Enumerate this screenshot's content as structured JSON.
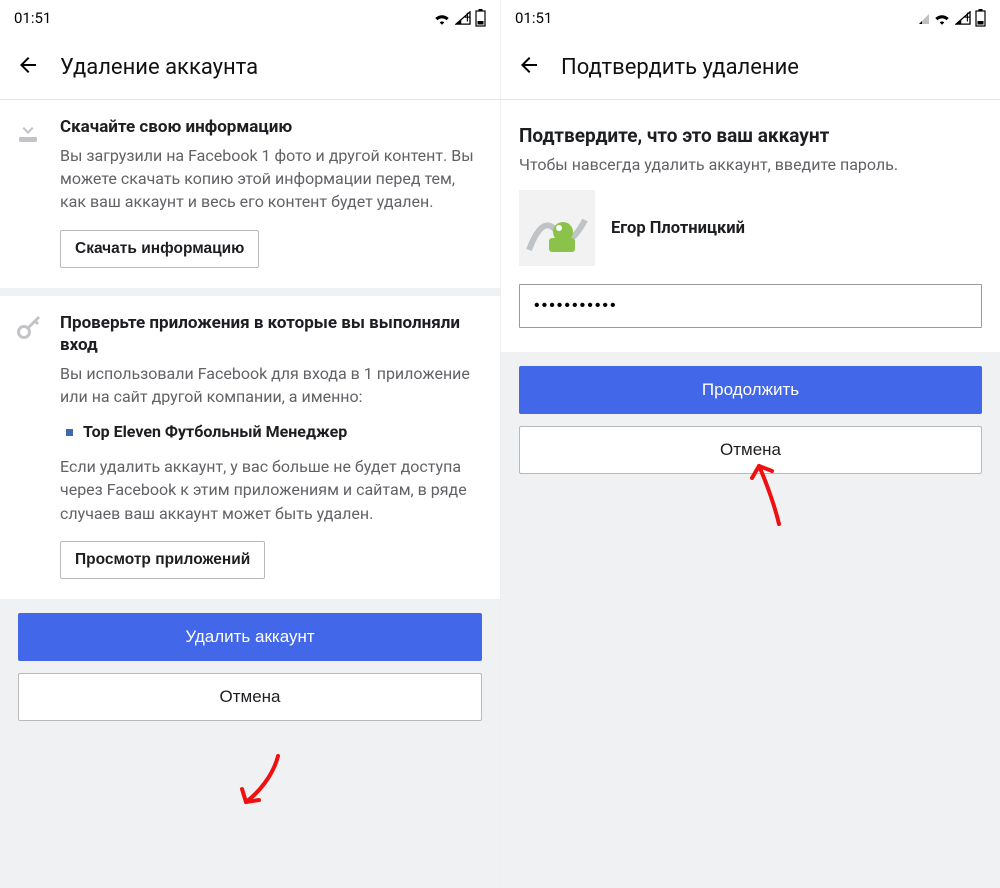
{
  "status": {
    "time": "01:51"
  },
  "left": {
    "nav_title": "Удаление аккаунта",
    "download": {
      "heading": "Скачайте свою информацию",
      "body": "Вы загрузили на Facebook 1 фото и другой контент. Вы можете скачать копию этой информации перед тем, как ваш аккаунт и весь его контент будет удален.",
      "button": "Скачать информацию"
    },
    "apps": {
      "heading": "Проверьте приложения в которые вы выполняли вход",
      "intro": "Вы использовали Facebook для входа в 1 приложение или на сайт другой компании, а именно:",
      "app_name": "Top Eleven Футбольный Менеджер",
      "explain": "Если удалить аккаунт, у вас больше не будет доступа через Facebook к этим приложениям и сайтам, в ряде случаев ваш аккаунт может быть удален.",
      "button": "Просмотр приложений"
    },
    "primary": "Удалить аккаунт",
    "cancel": "Отмена"
  },
  "right": {
    "nav_title": "Подтвердить удаление",
    "heading": "Подтвердите, что это ваш аккаунт",
    "sub": "Чтобы навсегда удалить аккаунт, введите пароль.",
    "user": "Егор Плотницкий",
    "password_value": "•••••••••••",
    "primary": "Продолжить",
    "cancel": "Отмена"
  }
}
